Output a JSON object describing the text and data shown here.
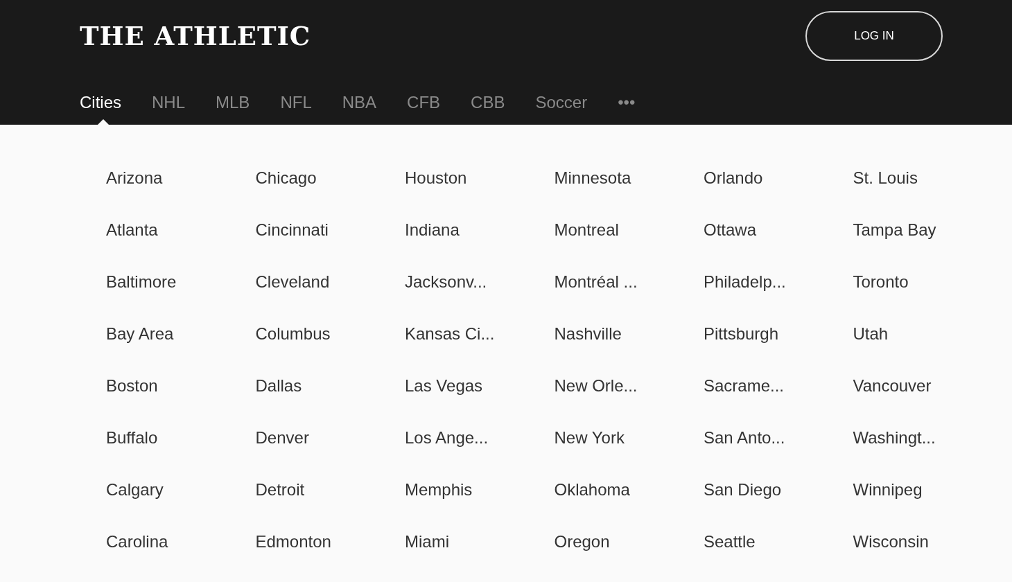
{
  "header": {
    "logo": "THE ATHLETIC",
    "login_button": "LOG IN"
  },
  "tabs": [
    {
      "label": "Cities",
      "selected": true
    },
    {
      "label": "NHL",
      "selected": false
    },
    {
      "label": "MLB",
      "selected": false
    },
    {
      "label": "NFL",
      "selected": false
    },
    {
      "label": "NBA",
      "selected": false
    },
    {
      "label": "CFB",
      "selected": false
    },
    {
      "label": "CBB",
      "selected": false
    },
    {
      "label": "Soccer",
      "selected": false
    },
    {
      "label": "•••",
      "selected": false
    }
  ],
  "city_columns": [
    [
      "Arizona",
      "Atlanta",
      "Baltimore",
      "Bay Area",
      "Boston",
      "Buffalo",
      "Calgary",
      "Carolina"
    ],
    [
      "Chicago",
      "Cincinnati",
      "Cleveland",
      "Columbus",
      "Dallas",
      "Denver",
      "Detroit",
      "Edmonton"
    ],
    [
      "Houston",
      "Indiana",
      "Jacksonv...",
      "Kansas Ci...",
      "Las Vegas",
      "Los Ange...",
      "Memphis",
      "Miami"
    ],
    [
      "Minnesota",
      "Montreal",
      "Montréal ...",
      "Nashville",
      "New Orle...",
      "New York",
      "Oklahoma",
      "Oregon"
    ],
    [
      "Orlando",
      "Ottawa",
      "Philadelp...",
      "Pittsburgh",
      "Sacrame...",
      "San Anto...",
      "San Diego",
      "Seattle"
    ],
    [
      "St. Louis",
      "Tampa Bay",
      "Toronto",
      "Utah",
      "Vancouver",
      "Washingt...",
      "Winnipeg",
      "Wisconsin"
    ]
  ]
}
